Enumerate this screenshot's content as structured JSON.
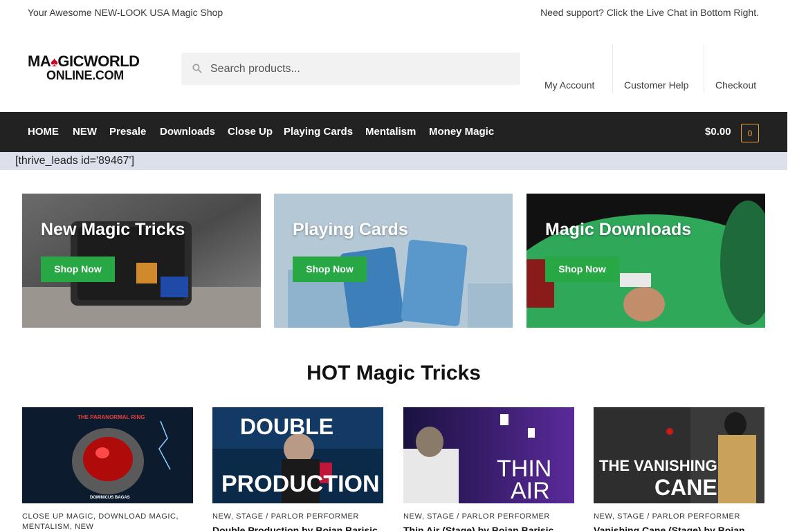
{
  "topbar": {
    "tagline": "Your Awesome NEW-LOOK USA Magic Shop",
    "support": "Need support? Click the Live Chat in Bottom Right."
  },
  "logo": {
    "line1_a": "MA",
    "line1_b": "GICWORLD",
    "line2": "ONLINE.COM"
  },
  "search": {
    "placeholder": "Search products..."
  },
  "account_links": [
    "My Account",
    "Customer Help",
    "Checkout"
  ],
  "nav": {
    "items": [
      "HOME",
      "NEW",
      "Presale",
      "Downloads",
      "Close Up",
      "Playing Cards",
      "Mentalism",
      "Money Magic"
    ],
    "cart_total": "$0.00",
    "cart_count": "0"
  },
  "shortcode": "[thrive_leads id='89467']",
  "promos": [
    {
      "title": "New Magic Tricks",
      "button": "Shop Now"
    },
    {
      "title": "Playing Cards",
      "button": "Shop Now"
    },
    {
      "title": "Magic Downloads",
      "button": "Shop Now"
    }
  ],
  "section_title": "HOT Magic Tricks",
  "products": [
    {
      "categories": "CLOSE UP MAGIC, DOWNLOAD MAGIC, MENTALISM, NEW",
      "name": "",
      "img_text1": "THE PARANORMAL RING",
      "img_text2": "DOMINICUS BAGAS"
    },
    {
      "categories": "NEW, STAGE / PARLOR PERFORMER",
      "name": "Double Production by Bojan Barisic",
      "img_text1": "DOUBLE",
      "img_text2": "PRODUCTION"
    },
    {
      "categories": "NEW, STAGE / PARLOR PERFORMER",
      "name": "Thin Air (Stage) by Bojan Barisic",
      "img_text1": "THIN",
      "img_text2": "AIR"
    },
    {
      "categories": "NEW, STAGE / PARLOR PERFORMER",
      "name": "Vanishing Cane (Stage) by Bojan",
      "img_text1": "THE VANISHING",
      "img_text2": "CANE"
    }
  ],
  "colors": {
    "nav_bg": "#222222",
    "button_green": "#27a844",
    "cart_accent": "#e8a33d",
    "shortcode_bg": "#dbe0ea"
  }
}
